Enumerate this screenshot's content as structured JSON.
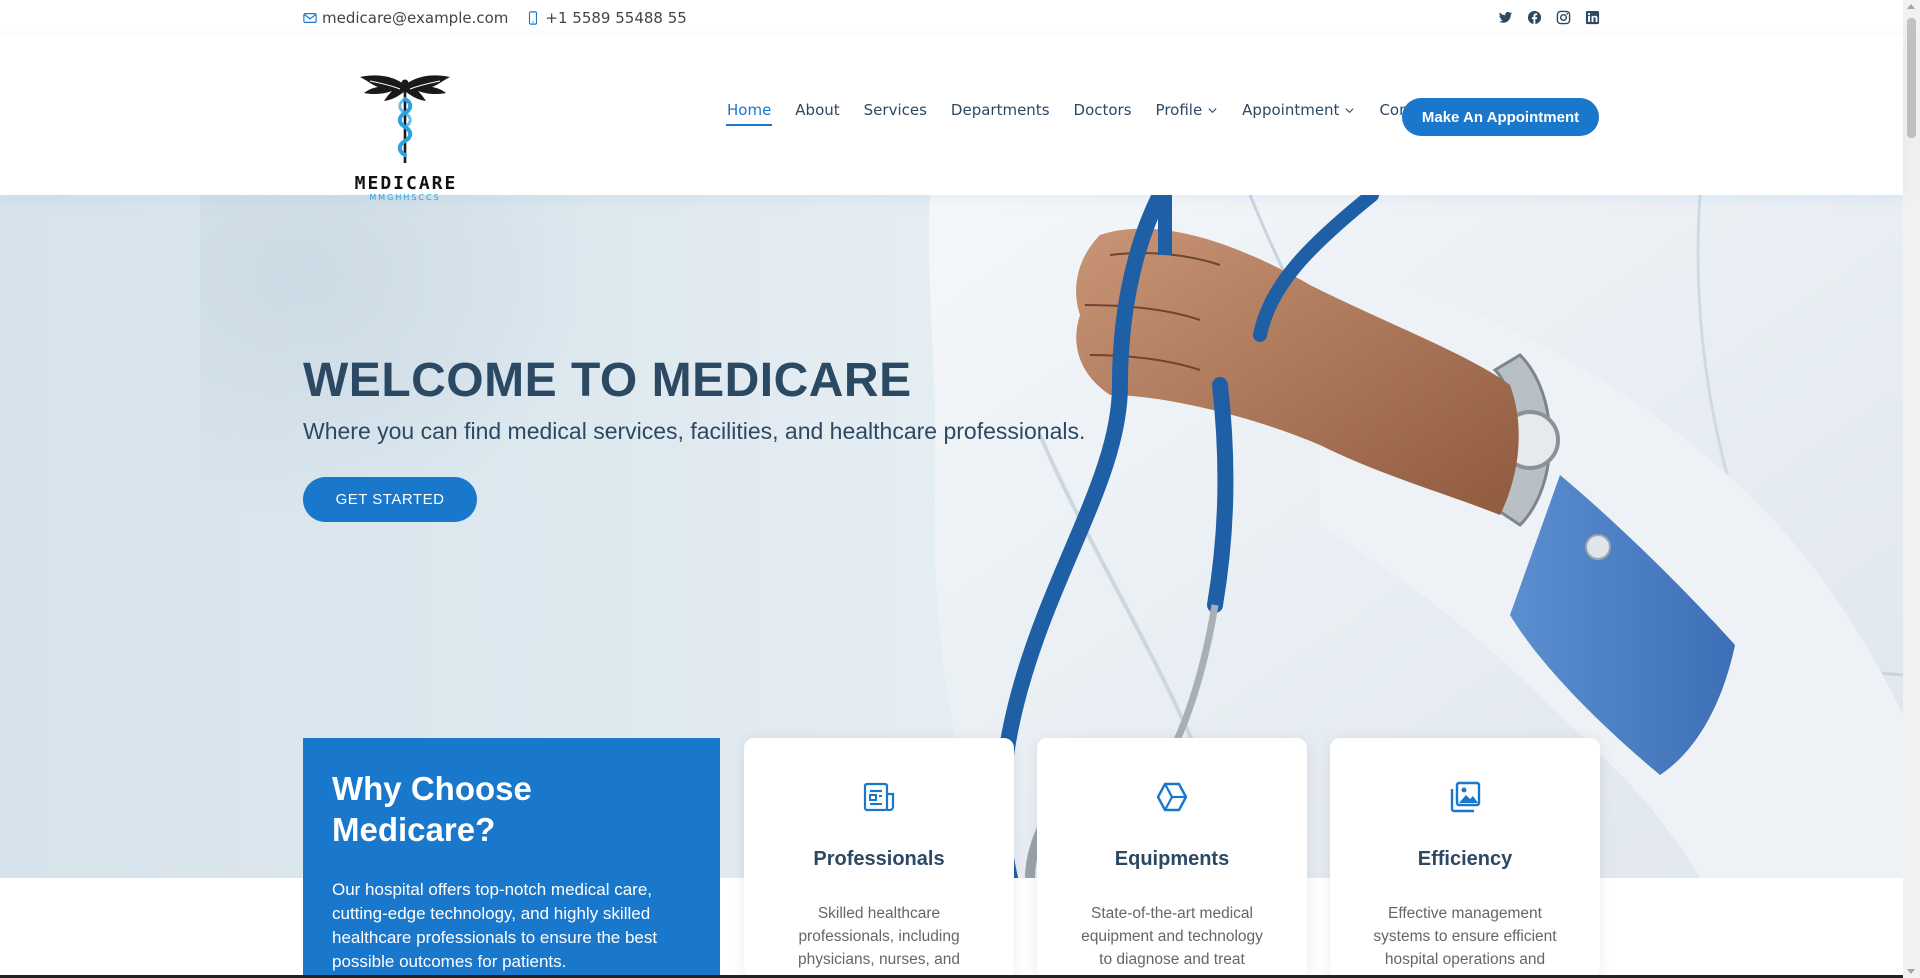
{
  "topbar": {
    "email": "medicare@example.com",
    "phone": "+1 5589 55488 55",
    "social_icons": [
      "twitter-icon",
      "facebook-icon",
      "instagram-icon",
      "linkedin-icon"
    ]
  },
  "logo": {
    "name": "MEDICARE",
    "tagline": "MMGHHSCCS"
  },
  "nav": {
    "items": [
      {
        "label": "Home",
        "active": true
      },
      {
        "label": "About"
      },
      {
        "label": "Services"
      },
      {
        "label": "Departments"
      },
      {
        "label": "Doctors"
      },
      {
        "label": "Profile",
        "dropdown": true
      },
      {
        "label": "Appointment",
        "dropdown": true
      },
      {
        "label": "Contact"
      }
    ],
    "cta_label": "Make An Appointment"
  },
  "hero": {
    "title": "WELCOME TO MEDICARE",
    "subtitle": "Where you can find medical services, facilities, and healthcare professionals.",
    "button_label": "GET STARTED"
  },
  "why": {
    "title": "Why Choose Medicare?",
    "text": "Our hospital offers top-notch medical care, cutting-edge technology, and highly skilled healthcare professionals to ensure the best possible outcomes for patients."
  },
  "features": [
    {
      "icon": "document-icon",
      "title": "Professionals",
      "text": "Skilled healthcare professionals, including physicians, nurses, and"
    },
    {
      "icon": "cube-icon",
      "title": "Equipments",
      "text": "State-of-the-art medical equipment and technology to diagnose and treat patients"
    },
    {
      "icon": "images-icon",
      "title": "Efficiency",
      "text": "Effective management systems to ensure efficient hospital operations and"
    }
  ],
  "colors": {
    "accent": "#1977cc",
    "heading": "#2c4964"
  }
}
